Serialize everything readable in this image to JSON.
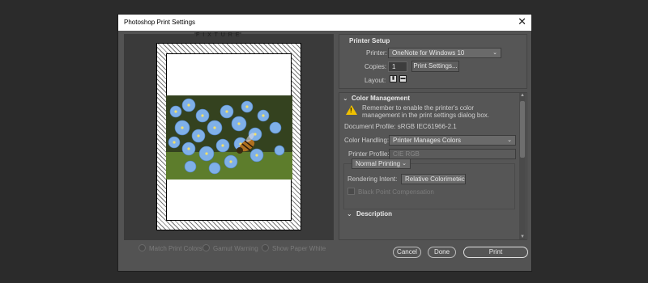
{
  "window": {
    "title": "Photoshop Print Settings",
    "close_glyph": "✕"
  },
  "preview": {
    "top_label": "F I X T U R E",
    "checkboxes": [
      {
        "label": "Match Print Colors",
        "checked": false
      },
      {
        "label": "Gamut Warning",
        "checked": false
      },
      {
        "label": "Show Paper White",
        "checked": false
      }
    ]
  },
  "printer_setup": {
    "heading": "Printer Setup",
    "printer_label": "Printer:",
    "printer_value": "OneNote for Windows 10",
    "copies_label": "Copies:",
    "copies_value": "1",
    "print_settings_button": "Print Settings...",
    "layout_label": "Layout:",
    "layout_icons": [
      "portrait-icon",
      "landscape-icon"
    ]
  },
  "color_management": {
    "heading": "Color Management",
    "collapse_glyph": "⌄",
    "warning_text_line1": "Remember to enable the printer's color",
    "warning_text_line2": "management in the print settings dialog box.",
    "document_profile_label": "Document Profile: sRGB IEC61966-2.1",
    "color_handling_label": "Color Handling:",
    "color_handling_value": "Printer Manages Colors",
    "printer_profile_label": "Printer Profile:",
    "printer_profile_value": "CIE RGB",
    "normal_printing_value": "Normal Printing",
    "rendering_intent_label": "Rendering Intent:",
    "rendering_intent_value": "Relative Colorimetric",
    "black_point_label": "Black Point Compensation",
    "description_heading": "Description"
  },
  "footer": {
    "cancel_label": "Cancel",
    "done_label": "Done",
    "print_label": "Print"
  },
  "colors": {
    "dialog_bg": "#535353",
    "warning": "#f0c000"
  }
}
